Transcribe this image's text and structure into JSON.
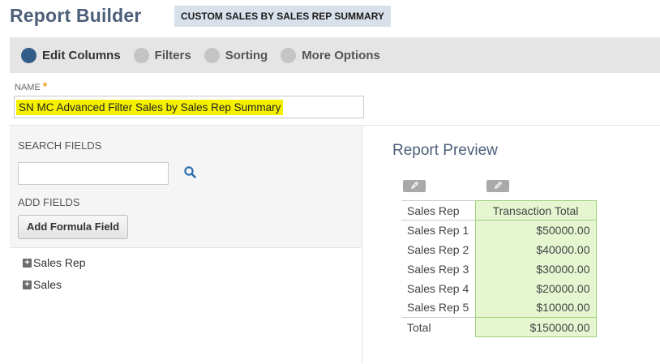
{
  "header": {
    "title": "Report Builder",
    "badge": "CUSTOM SALES BY SALES REP SUMMARY"
  },
  "steps": [
    {
      "label": "Edit Columns",
      "active": true
    },
    {
      "label": "Filters",
      "active": false
    },
    {
      "label": "Sorting",
      "active": false
    },
    {
      "label": "More Options",
      "active": false
    }
  ],
  "name_field": {
    "label": "NAME",
    "required_marker": "*",
    "value": "SN MC Advanced Filter Sales by Sales Rep Summary"
  },
  "left_panel": {
    "search_label": "SEARCH FIELDS",
    "search_value": "",
    "add_fields_label": "ADD FIELDS",
    "formula_button": "Add Formula Field",
    "tree_items": [
      "Sales Rep",
      "Sales"
    ]
  },
  "preview": {
    "title": "Report Preview",
    "columns": [
      "Sales Rep",
      "Transaction Total"
    ],
    "rows": [
      {
        "rep": "Sales Rep 1",
        "total": "$50000.00"
      },
      {
        "rep": "Sales Rep 2",
        "total": "$40000.00"
      },
      {
        "rep": "Sales Rep 3",
        "total": "$30000.00"
      },
      {
        "rep": "Sales Rep 4",
        "total": "$20000.00"
      },
      {
        "rep": "Sales Rep 5",
        "total": "$10000.00"
      }
    ],
    "total_row": {
      "label": "Total",
      "total": "$150000.00"
    }
  },
  "colors": {
    "accent": "#325d88",
    "title": "#4d5f79",
    "highlight": "#f4f000",
    "column_highlight": "#e5f6d1"
  },
  "icons": {
    "search": "search-icon",
    "edit": "pencil-icon",
    "expand": "plus-icon"
  }
}
